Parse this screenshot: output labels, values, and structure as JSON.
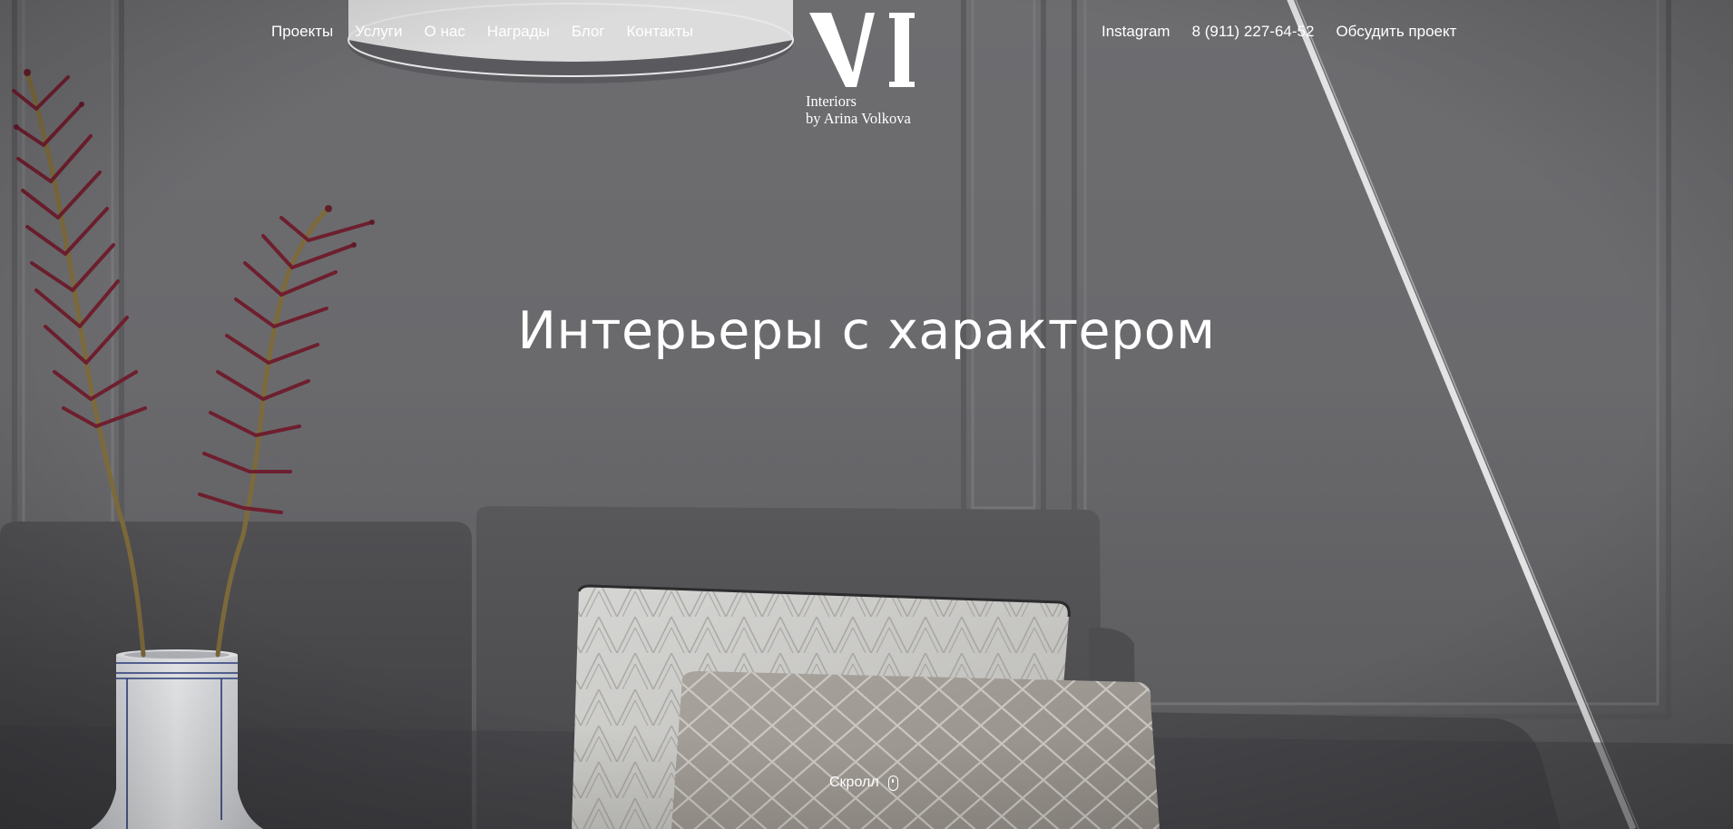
{
  "nav": {
    "left": [
      {
        "label": "Проекты"
      },
      {
        "label": "Услуги"
      },
      {
        "label": "О нас"
      },
      {
        "label": "Награды"
      },
      {
        "label": "Блог"
      },
      {
        "label": "Контакты"
      }
    ],
    "right": {
      "instagram": "Instagram",
      "phone": "8 (911) 227-64-52",
      "cta": "Обсудить проект"
    }
  },
  "logo": {
    "mark": "VI",
    "line1": "Interiors",
    "line2": "by Arina Volkova"
  },
  "hero": {
    "headline": "Интерьеры с характером"
  },
  "scroll": {
    "label": "Скролл",
    "icon": "mouse-icon"
  },
  "colors": {
    "text": "#ffffff",
    "wall": "#6b6b6e",
    "sofa": "#4a4a4d",
    "plant": "#6e1f2e"
  }
}
